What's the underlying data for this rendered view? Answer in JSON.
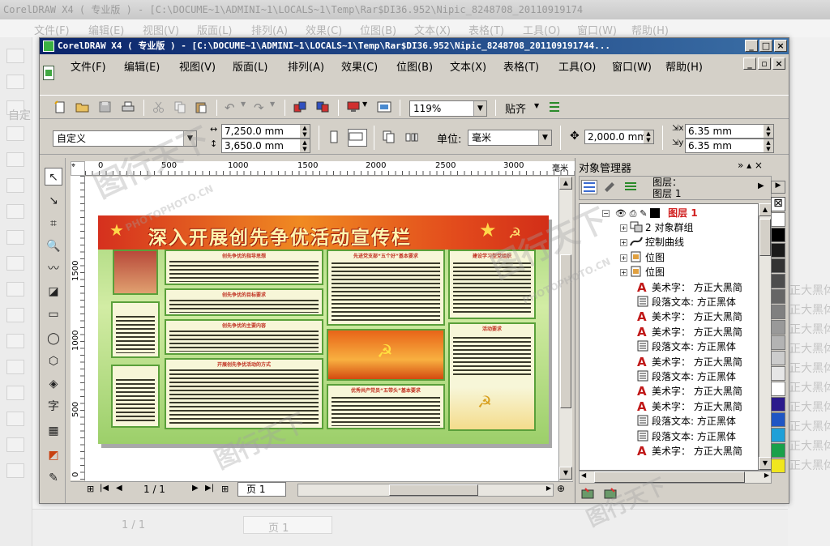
{
  "bg": {
    "title": "CorelDRAW X4 ( 专业版 ) - [C:\\DOCUME~1\\ADMINI~1\\LOCALS~1\\Temp\\Rar$DI36.952\\Nipic_8248708_20110919174",
    "menu": [
      "文件(F)",
      "编辑(E)",
      "视图(V)",
      "版面(L)",
      "排列(A)",
      "效果(C)",
      "位图(B)",
      "文本(X)",
      "表格(T)",
      "工具(O)",
      "窗口(W)",
      "帮助(H)"
    ],
    "right_text": [
      "正大黑体",
      "正大黑体",
      "正大黑体",
      "正大黑体",
      "正大黑体",
      "正大黑体",
      "正大黑体",
      "正大黑体",
      "正大黑体",
      "正大黑体"
    ],
    "page_counter": "1 / 1",
    "page_tab": "页 1",
    "preset": "自定"
  },
  "window": {
    "title": "CorelDRAW X4 ( 专业版 ) - [C:\\DOCUME~1\\ADMINI~1\\LOCALS~1\\Temp\\Rar$DI36.952\\Nipic_8248708_201109191744...",
    "menu": [
      "文件(F)",
      "编辑(E)",
      "视图(V)",
      "版面(L)",
      "排列(A)",
      "效果(C)",
      "位图(B)",
      "文本(X)",
      "表格(T)",
      "工具(O)",
      "窗口(W)",
      "帮助(H)"
    ]
  },
  "toolbar": {
    "zoom": "119%",
    "snap": "贴齐"
  },
  "property_bar": {
    "preset": "自定义",
    "width": "7,250.0 mm",
    "height": "3,650.0 mm",
    "unit_label": "单位:",
    "unit": "毫米",
    "nudge": "2,000.0 mm",
    "dup_x": "6.35 mm",
    "dup_y": "6.35 mm"
  },
  "rulers": {
    "h_ticks": [
      "0",
      "500",
      "1000",
      "1500",
      "2000",
      "2500",
      "3000"
    ],
    "h_unit": "毫米",
    "v_ticks": [
      "1500",
      "1000",
      "500",
      "0"
    ],
    "v_unit": "毫米"
  },
  "poster": {
    "title": "深入开展创先争优活动宣传栏",
    "panel_heads": [
      "创先争优的指导思想",
      "创先争优的目标要求",
      "创先争优的主要内容",
      "开展创先争优活动的方式",
      "先进党支部“五个好”基本要求",
      "建设学习型党组织",
      "活动要求",
      "优秀共产党员“五带头”基本要求"
    ]
  },
  "status": {
    "page_counter": "1 / 1",
    "page_tab": "页 1"
  },
  "docker": {
    "title": "对象管理器",
    "layer_label": "图层：",
    "layer_name": "图层 1",
    "root_layer": "图层 1",
    "items": [
      {
        "label": "2 对象群组",
        "icon": "group-icon",
        "expand": true
      },
      {
        "label": "控制曲线",
        "icon": "curve-icon",
        "expand": true
      },
      {
        "label": "位图",
        "icon": "bitmap-icon",
        "expand": true
      },
      {
        "label": "位图",
        "icon": "bitmap-icon",
        "expand": true
      },
      {
        "label": "美术字： 方正大黑简",
        "icon": "artistic-text-icon",
        "expand": false
      },
      {
        "label": "段落文本: 方正黑体",
        "icon": "paragraph-text-icon",
        "expand": false
      },
      {
        "label": "美术字： 方正大黑简",
        "icon": "artistic-text-icon",
        "expand": false
      },
      {
        "label": "美术字： 方正大黑简",
        "icon": "artistic-text-icon",
        "expand": false
      },
      {
        "label": "段落文本: 方正黑体",
        "icon": "paragraph-text-icon",
        "expand": false
      },
      {
        "label": "美术字： 方正大黑简",
        "icon": "artistic-text-icon",
        "expand": false
      },
      {
        "label": "段落文本: 方正黑体",
        "icon": "paragraph-text-icon",
        "expand": false
      },
      {
        "label": "美术字： 方正大黑简",
        "icon": "artistic-text-icon",
        "expand": false
      },
      {
        "label": "美术字： 方正大黑简",
        "icon": "artistic-text-icon",
        "expand": false
      },
      {
        "label": "段落文本: 方正黑体",
        "icon": "paragraph-text-icon",
        "expand": false
      },
      {
        "label": "段落文本: 方正黑体",
        "icon": "paragraph-text-icon",
        "expand": false
      },
      {
        "label": "美术字： 方正大黑简",
        "icon": "artistic-text-icon",
        "expand": false
      }
    ]
  },
  "palette": [
    "#ffffff",
    "#000000",
    "#1a1a1a",
    "#333333",
    "#4d4d4d",
    "#666666",
    "#808080",
    "#999999",
    "#b3b3b3",
    "#cccccc",
    "#e6e6e6",
    "#ffffff",
    "#2b1a8c",
    "#1f56c4",
    "#1ea0d8",
    "#1aa04a",
    "#f0e61e"
  ],
  "watermark": {
    "text": "图行天下",
    "sub": "PHOTOPHOTO.CN"
  }
}
